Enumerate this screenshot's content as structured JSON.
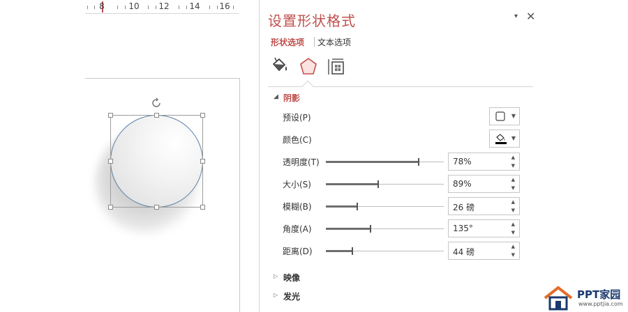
{
  "ruler": {
    "labels": [
      "8",
      "10",
      "12",
      "14",
      "16"
    ]
  },
  "pane": {
    "title": "设置形状格式",
    "menu_glyph": "▾",
    "close_glyph": "✕",
    "tabs": [
      {
        "label": "形状选项",
        "active": true
      },
      {
        "label": "文本选项",
        "active": false
      }
    ],
    "categories": [
      "fill-line-icon",
      "effects-icon",
      "size-properties-icon"
    ],
    "section": {
      "title": "阴影",
      "expanded": true,
      "preset_label": "预设(P)",
      "color_label": "颜色(C)",
      "sliders": [
        {
          "label": "透明度(T)",
          "value": "78%",
          "level": 0.78
        },
        {
          "label": "大小(S)",
          "value": "89%",
          "level": 0.44
        },
        {
          "label": "模糊(B)",
          "value": "26 磅",
          "level": 0.26
        },
        {
          "label": "角度(A)",
          "value": "135°",
          "level": 0.375
        },
        {
          "label": "距离(D)",
          "value": "44 磅",
          "level": 0.22
        }
      ]
    },
    "collapsed_sections": [
      "映像",
      "发光"
    ]
  },
  "watermark": {
    "brand": "PPT家园",
    "url": "www.pptjia.com"
  },
  "colors": {
    "accent": "#c0504d",
    "shape_outline": "#5b7fa8",
    "watermark": "#1a3a6e"
  }
}
